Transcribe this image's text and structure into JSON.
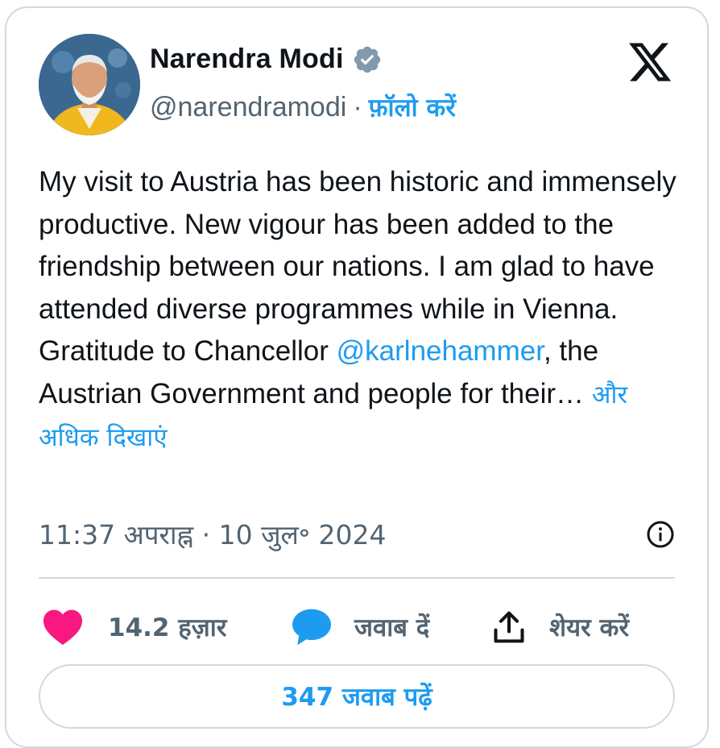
{
  "author": {
    "display_name": "Narendra Modi",
    "handle": "@narendramodi",
    "separator": "·",
    "follow_label": "फ़ॉलो करें",
    "verified_color": "#829aab"
  },
  "tweet": {
    "text_before_mention": "My visit to Austria has been historic and immensely productive. New vigour has been added to the friendship between our nations. I am glad to have attended diverse programmes while in Vienna. Gratitude to Chancellor ",
    "mention": "@karlnehammer",
    "text_after_mention": ", the Austrian Government and people for their…",
    "show_more_label": "और अधिक दिखाएं",
    "timestamp": "11:37 अपराह्न · 10 जुल॰ 2024"
  },
  "actions": {
    "like_count": "14.2 हज़ार",
    "reply_label": "जवाब दें",
    "share_label": "शेयर करें"
  },
  "footer": {
    "read_replies_label": "347 जवाब पढ़ें"
  },
  "icons": {
    "logo": "x-logo-icon",
    "verified": "verified-badge-icon",
    "info": "info-icon",
    "like": "heart-icon",
    "reply": "speech-bubble-icon",
    "share": "share-upload-icon"
  },
  "colors": {
    "accent": "#1d9bf0",
    "like": "#f91880",
    "text": "#0f1419",
    "muted": "#536471",
    "border": "#cfd9de"
  }
}
